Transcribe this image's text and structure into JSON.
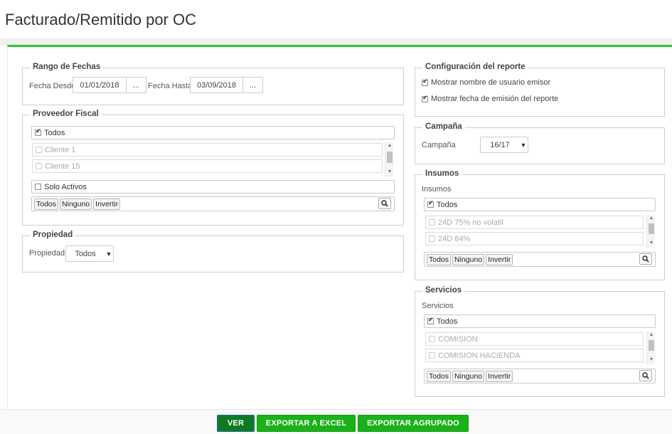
{
  "page": {
    "title": "Facturado/Remitido por OC"
  },
  "rango_fechas": {
    "legend": "Rango de Fechas",
    "desde_label": "Fecha Desde",
    "desde_value": "01/01/2018",
    "hasta_label": "Fecha Hasta",
    "hasta_value": "03/09/2018",
    "picker_label": "..."
  },
  "proveedor": {
    "legend": "Proveedor Fiscal",
    "todos_label": "Todos",
    "items": [
      "Cliente 1",
      "Cliente 15"
    ],
    "solo_activos_label": "Solo Activos",
    "buttons": {
      "todos": "Todos",
      "ninguno": "Ninguno",
      "invertir": "Invertir"
    }
  },
  "propiedad": {
    "legend": "Propiedad",
    "label": "Propiedad",
    "selected": "Todos"
  },
  "config": {
    "legend": "Configuración del reporte",
    "options": [
      {
        "label": "Mostrar nombre de usuario emisor",
        "checked": true
      },
      {
        "label": "Mostrar fecha de emisión del reporte",
        "checked": true
      }
    ]
  },
  "campana": {
    "legend": "Campaña",
    "label": "Campaña",
    "selected": "16/17"
  },
  "insumos": {
    "legend": "Insumos",
    "sublabel": "Insumos",
    "todos_label": "Todos",
    "items": [
      "24D 75% no volatil",
      "24D 84%"
    ],
    "buttons": {
      "todos": "Todos",
      "ninguno": "Ninguno",
      "invertir": "Invertir"
    }
  },
  "servicios": {
    "legend": "Servicios",
    "sublabel": "Servicios",
    "todos_label": "Todos",
    "items": [
      "COMISION",
      "COMISION HACIENDA"
    ],
    "buttons": {
      "todos": "Todos",
      "ninguno": "Ninguno",
      "invertir": "Invertir"
    }
  },
  "actions": {
    "ver": "VER",
    "exportar_excel": "EXPORTAR A EXCEL",
    "exportar_agrupado": "EXPORTAR AGRUPADO"
  },
  "colors": {
    "accent_green": "#2fc52f",
    "button_green": "#19b219",
    "button_dark_green": "#0e7a22",
    "button_border_teal": "#1b6f6a"
  },
  "icons": {
    "search": "search-icon",
    "caret": "caret-down-icon",
    "check": "checkmark-icon"
  }
}
